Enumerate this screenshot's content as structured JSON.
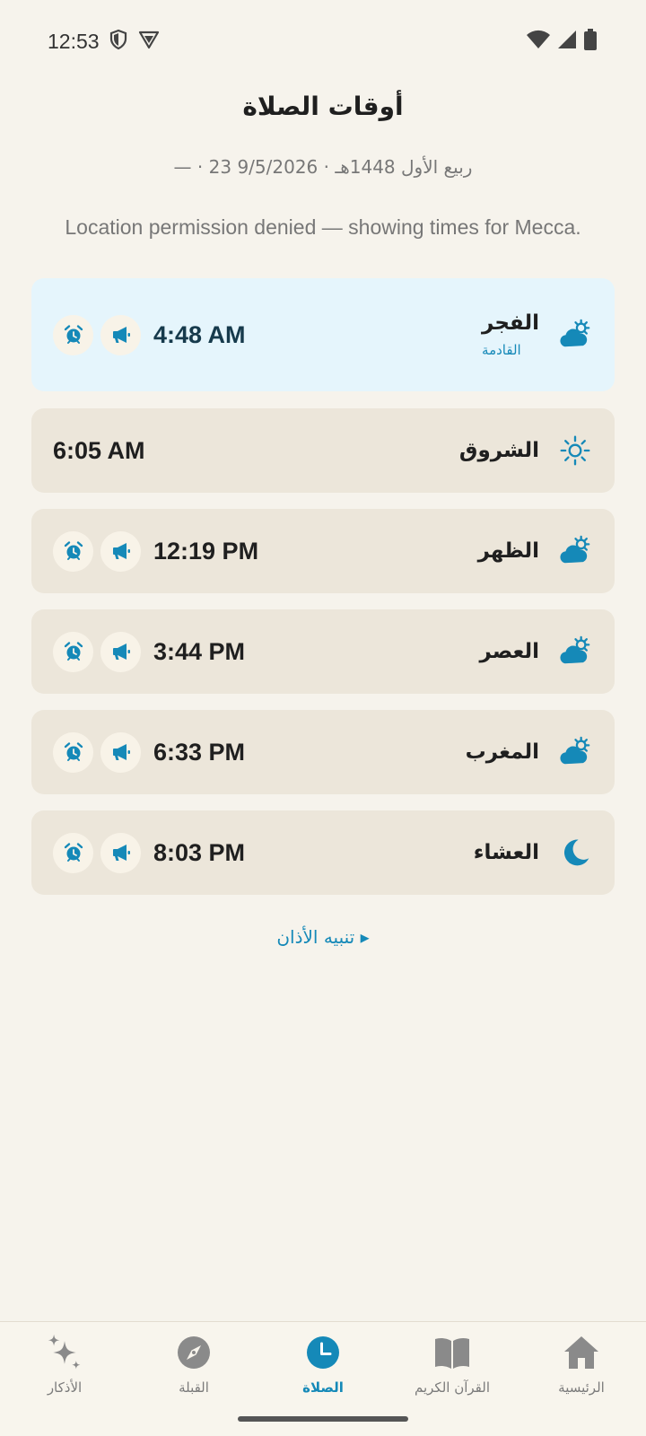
{
  "status_bar": {
    "time": "12:53"
  },
  "page": {
    "title": "أوقات الصلاة",
    "date_line": "— · 23 ربيع الأول 1448هـ · 9/5/2026",
    "location_note": "Location permission denied — showing times for Mecca."
  },
  "prayers": [
    {
      "name": "الفجر",
      "time": "4:48 AM",
      "badge": "القادمة",
      "icon": "cloud-sun-icon"
    },
    {
      "name": "الشروق",
      "time": "6:05 AM",
      "icon": "sun-icon"
    },
    {
      "name": "الظهر",
      "time": "12:19 PM",
      "icon": "cloud-sun-icon"
    },
    {
      "name": "العصر",
      "time": "3:44 PM",
      "icon": "cloud-sun-icon"
    },
    {
      "name": "المغرب",
      "time": "6:33 PM",
      "icon": "cloud-sun-icon"
    },
    {
      "name": "العشاء",
      "time": "8:03 PM",
      "icon": "moon-icon"
    }
  ],
  "adhan_link": "▸ تنبيه الأذان",
  "nav": {
    "items": [
      {
        "label": "الرئيسية",
        "icon": "home-icon"
      },
      {
        "label": "القرآن الكريم",
        "icon": "book-icon"
      },
      {
        "label": "الصلاة",
        "icon": "clock-icon",
        "active": true
      },
      {
        "label": "القبلة",
        "icon": "compass-icon"
      },
      {
        "label": "الأذكار",
        "icon": "sparkle-icon"
      }
    ]
  },
  "colors": {
    "accent": "#1589b8",
    "card": "#ece6da",
    "next_card": "#e5f5fc",
    "background": "#f6f3ec"
  }
}
